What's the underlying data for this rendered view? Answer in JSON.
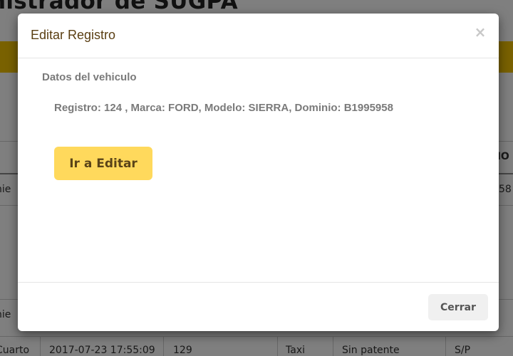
{
  "background": {
    "page_title": "nistrador de SUGPA",
    "table": {
      "header_fragment": "NIO",
      "rows": [
        {
          "col1": "nie",
          "col_last": "58"
        },
        {
          "col1": "nie"
        },
        {
          "col1": "Cuarto",
          "datetime": "2017-07-23 17:55:09",
          "number": "129",
          "type": "Taxi",
          "plate": "Sin patente",
          "code": "S/P"
        }
      ]
    }
  },
  "modal": {
    "title": "Editar Registro",
    "close_symbol": "×",
    "section_label": "Datos del vehiculo",
    "vehicle_info": "Registro: 124 , Marca: FORD, Modelo: SIERRA, Dominio: B1995958",
    "edit_button_label": "Ir a Editar",
    "footer_close_label": "Cerrar"
  },
  "colors": {
    "accent_yellow": "#f3c200",
    "edit_button_bg": "#ffd95c",
    "title_text": "#5a3e12"
  }
}
